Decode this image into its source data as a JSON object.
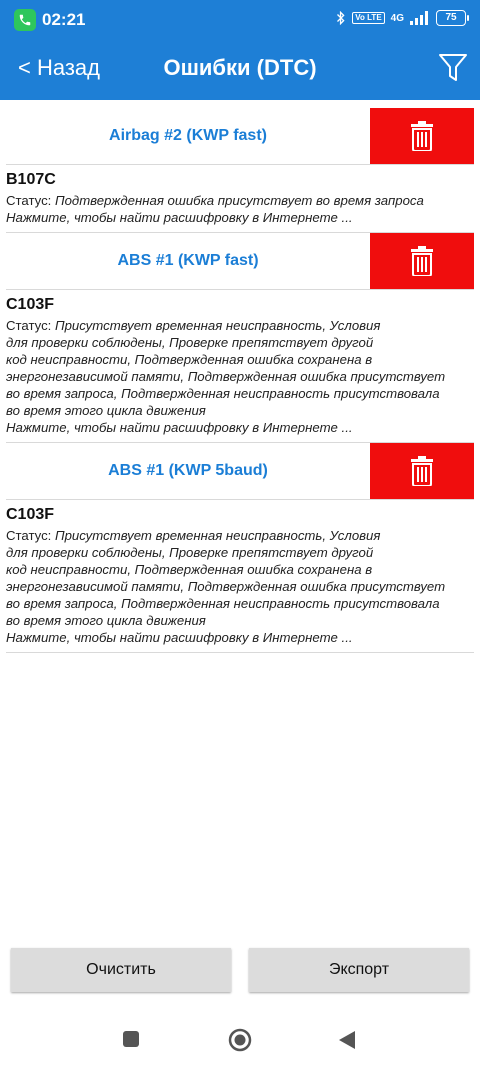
{
  "status_bar": {
    "time": "02:21",
    "network": "4G",
    "volte": "Vo LTE",
    "battery": "75",
    "icons": [
      "phone-icon",
      "bluetooth-icon",
      "signal-icon",
      "battery-icon"
    ]
  },
  "header": {
    "back_label": "< Назад",
    "title": "Ошибки (DTC)",
    "filter_icon": "filter-icon"
  },
  "status_prefix": "Статус: ",
  "entries": [
    {
      "ecu": "Airbag #2 (KWP fast)",
      "code": "B107C",
      "status_lines": [
        "Подтвержденная ошибка присутствует во время запроса"
      ],
      "hint": "Нажмите, чтобы найти расшифровку в Интернете ..."
    },
    {
      "ecu": "ABS #1 (KWP fast)",
      "code": "C103F",
      "status_lines": [
        "Присутствует временная неисправность, Условия",
        "для проверки соблюдены, Проверке препятствует другой",
        "код неисправности, Подтвержденная ошибка сохранена в",
        "энергонезависимой памяти, Подтвержденная ошибка присутствует",
        "во время запроса, Подтвержденная неисправность присутствовала",
        "во время этого цикла движения"
      ],
      "hint": "Нажмите, чтобы найти расшифровку в Интернете ..."
    },
    {
      "ecu": "ABS #1 (KWP 5baud)",
      "code": "C103F",
      "status_lines": [
        "Присутствует временная неисправность, Условия",
        "для проверки соблюдены, Проверке препятствует другой",
        "код неисправности, Подтвержденная ошибка сохранена в",
        "энергонезависимой памяти, Подтвержденная ошибка присутствует",
        "во время запроса, Подтвержденная неисправность присутствовала",
        "во время этого цикла движения"
      ],
      "hint": "Нажмите, чтобы найти расшифровку в Интернете ..."
    }
  ],
  "buttons": {
    "clear_label": "Очистить",
    "export_label": "Экспорт"
  },
  "nav": {
    "recent_icon": "square-icon",
    "home_icon": "circle-icon",
    "back_icon": "triangle-back-icon"
  },
  "colors": {
    "accent": "#1e7fd6",
    "delete": "#f00d0d",
    "ecu_text": "#1b7ed6"
  }
}
